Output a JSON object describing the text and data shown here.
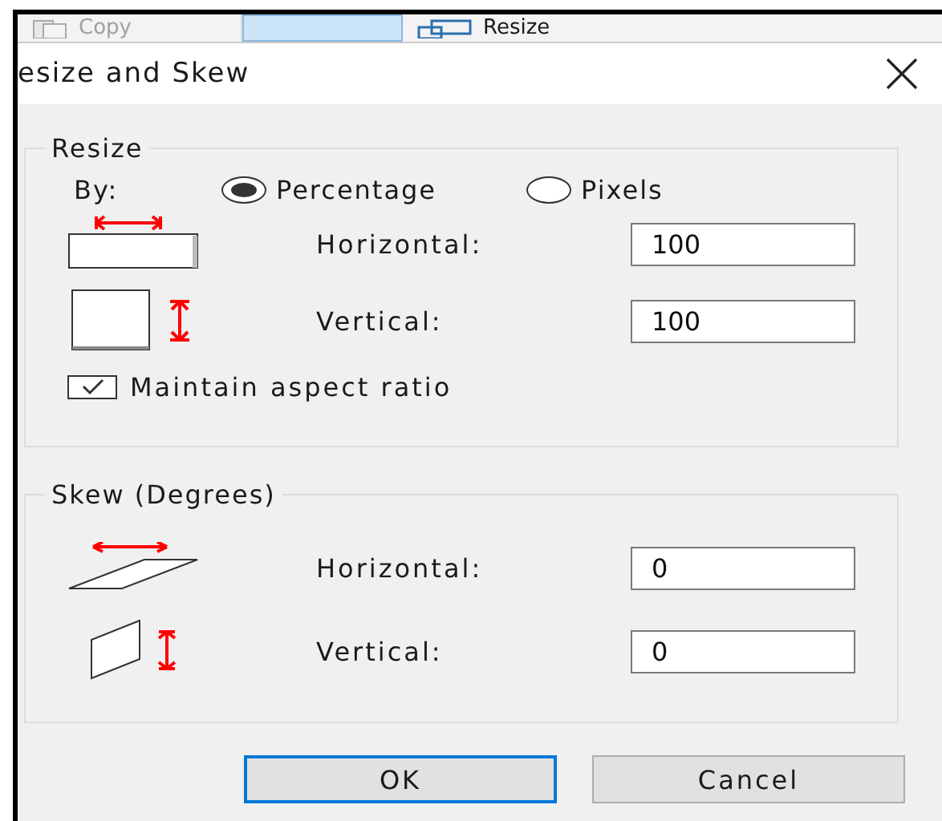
{
  "toolbar": [
    {
      "label": "Copy",
      "kind": "copy",
      "disabled": true,
      "selected": false
    },
    {
      "kind": "blank",
      "disabled": false,
      "selected": true
    },
    {
      "label": "Resize",
      "kind": "resize",
      "disabled": false,
      "selected": false
    }
  ],
  "dialog": {
    "title": "esize and Skew",
    "resize": {
      "title": "Resize",
      "by_label": "By:",
      "options": [
        {
          "label": "Percentage",
          "selected": true
        },
        {
          "label": "Pixels",
          "selected": false
        }
      ],
      "fields": [
        {
          "kind": "width",
          "label": "Horizontal:",
          "value": "100"
        },
        {
          "kind": "height",
          "label": "Vertical:",
          "value": "100"
        }
      ],
      "maintain_aspect": {
        "label": "Maintain aspect ratio",
        "checked": true
      }
    },
    "skew": {
      "title": "Skew (Degrees)",
      "fields": [
        {
          "kind": "hskew",
          "label": "Horizontal:",
          "value": "0"
        },
        {
          "kind": "vskew",
          "label": "Vertical:",
          "value": "0"
        }
      ]
    },
    "buttons": [
      {
        "label": "OK",
        "default": true
      },
      {
        "label": "Cancel",
        "default": false
      }
    ]
  }
}
